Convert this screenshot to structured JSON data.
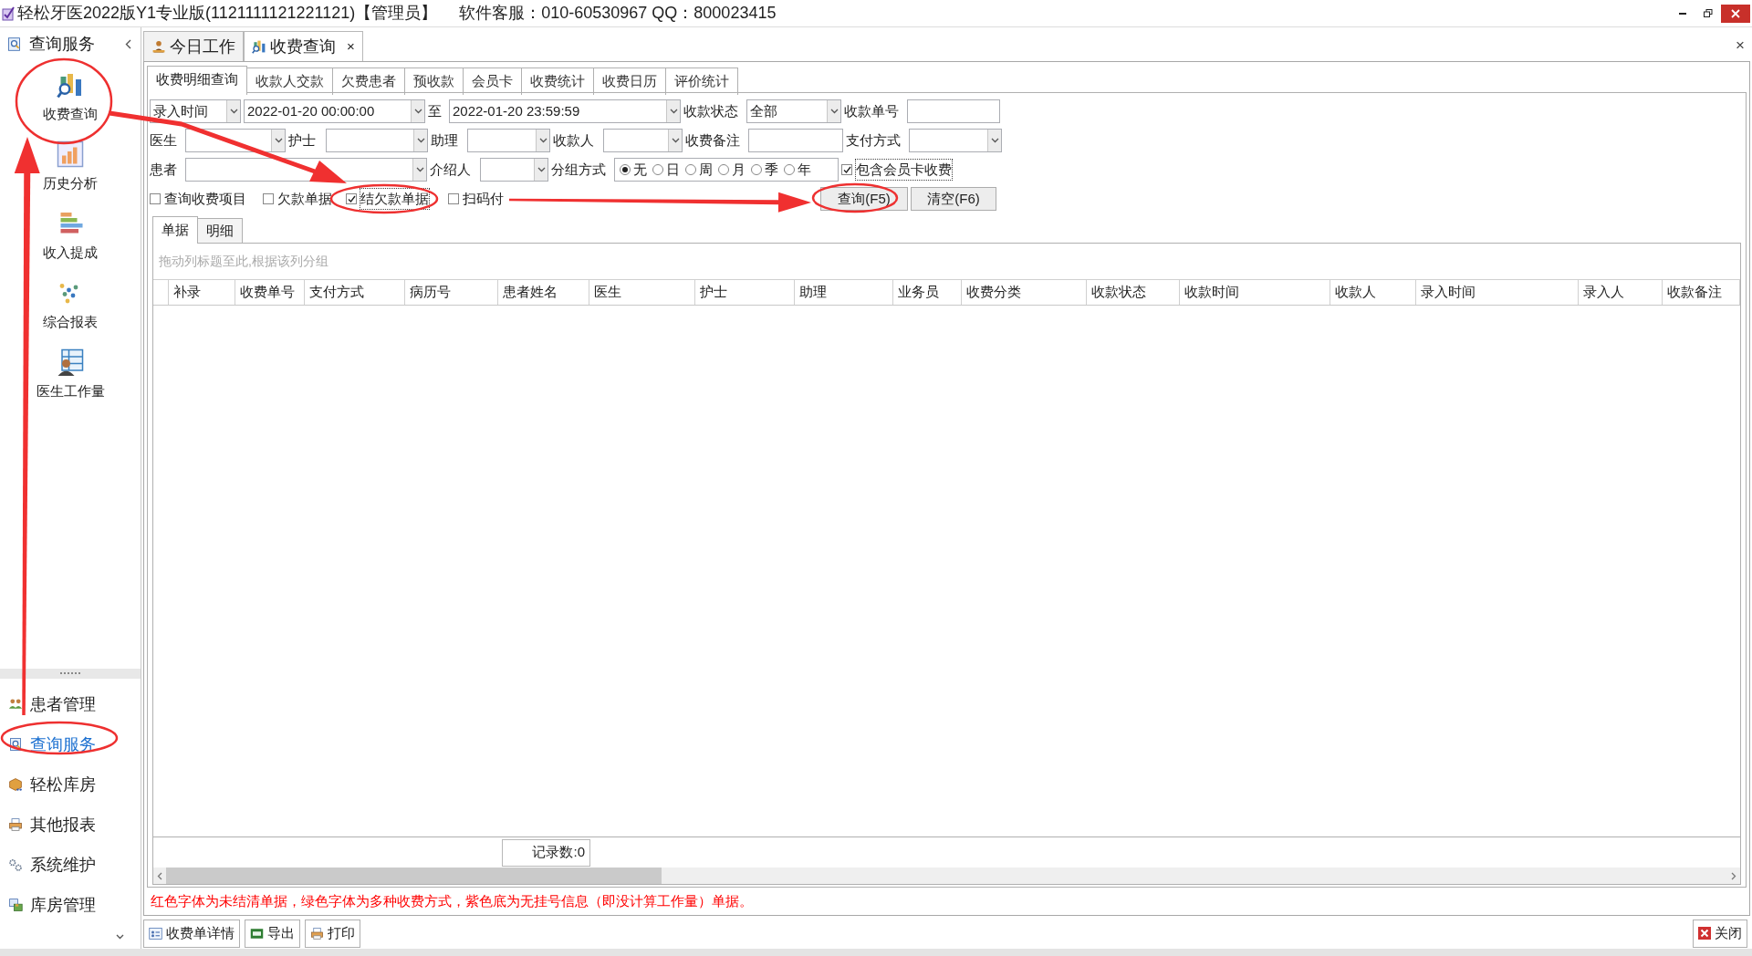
{
  "window": {
    "title": "轻松牙医2022版Y1专业版(1121111121221121)【管理员】",
    "support": "软件客服：010-60530967 QQ：800023415"
  },
  "sidebar": {
    "header": "查询服务",
    "tools": [
      {
        "label": "收费查询",
        "kind": "chart-search"
      },
      {
        "label": "历史分析",
        "kind": "bar-chart"
      },
      {
        "label": "收入提成",
        "kind": "stack"
      },
      {
        "label": "综合报表",
        "kind": "dots"
      },
      {
        "label": "医生工作量",
        "kind": "staff"
      }
    ],
    "nav": [
      {
        "label": "患者管理",
        "kind": "people",
        "selected": false
      },
      {
        "label": "查询服务",
        "kind": "search-doc",
        "selected": true
      },
      {
        "label": "轻松库房",
        "kind": "box",
        "selected": false
      },
      {
        "label": "其他报表",
        "kind": "printer",
        "selected": false
      },
      {
        "label": "系统维护",
        "kind": "gears",
        "selected": false
      },
      {
        "label": "库房管理",
        "kind": "windows",
        "selected": false
      }
    ]
  },
  "doc_tabs": [
    {
      "label": "今日工作",
      "kind": "worker",
      "selected": false,
      "closable": false
    },
    {
      "label": "收费查询",
      "kind": "chart-search",
      "selected": true,
      "closable": true
    }
  ],
  "doc_tab_close": "×",
  "panel_close": "×",
  "query_tabs": [
    {
      "label": "收费明细查询",
      "selected": true
    },
    {
      "label": "收款人交款",
      "selected": false
    },
    {
      "label": "欠费患者",
      "selected": false
    },
    {
      "label": "预收款",
      "selected": false
    },
    {
      "label": "会员卡",
      "selected": false
    },
    {
      "label": "收费统计",
      "selected": false
    },
    {
      "label": "收费日历",
      "selected": false
    },
    {
      "label": "评价统计",
      "selected": false
    }
  ],
  "filters": [
    [
      {
        "kind": "select",
        "value": "录入时间"
      },
      {
        "kind": "select",
        "value": "2022-01-20 00:00:00"
      },
      {
        "kind": "label",
        "text": "至"
      },
      {
        "kind": "select",
        "value": "2022-01-20 23:59:59"
      },
      {
        "kind": "label",
        "text": "收款状态"
      },
      {
        "kind": "select",
        "value": "全部"
      },
      {
        "kind": "label",
        "text": "收款单号"
      },
      {
        "kind": "input"
      }
    ],
    [
      {
        "kind": "label",
        "text": "医生"
      },
      {
        "kind": "select"
      },
      {
        "kind": "label",
        "text": "护士"
      },
      {
        "kind": "select"
      },
      {
        "kind": "label",
        "text": "助理"
      },
      {
        "kind": "select"
      },
      {
        "kind": "label",
        "text": "收款人"
      },
      {
        "kind": "select"
      },
      {
        "kind": "label",
        "text": "收费备注"
      },
      {
        "kind": "input"
      },
      {
        "kind": "label",
        "text": "支付方式"
      },
      {
        "kind": "select"
      }
    ],
    [
      {
        "kind": "label",
        "text": "患者"
      },
      {
        "kind": "select"
      },
      {
        "kind": "label",
        "text": "介绍人"
      },
      {
        "kind": "select"
      },
      {
        "kind": "label",
        "text": "分组方式"
      },
      {
        "kind": "radios",
        "options": [
          {
            "label": "无",
            "selected": true
          },
          {
            "label": "日",
            "selected": false
          },
          {
            "label": "周",
            "selected": false
          },
          {
            "label": "月",
            "selected": false
          },
          {
            "label": "季",
            "selected": false
          },
          {
            "label": "年",
            "selected": false
          }
        ]
      },
      {
        "kind": "checkbox",
        "label": "包含会员卡收费",
        "checked": true
      }
    ],
    [
      {
        "kind": "checkbox",
        "label": "查询收费项目",
        "checked": false
      },
      {
        "kind": "checkbox",
        "label": "欠款单据",
        "checked": false
      },
      {
        "kind": "checkbox",
        "label": "结欠款单据",
        "checked": true
      },
      {
        "kind": "checkbox",
        "label": "扫码付",
        "checked": false
      },
      {
        "kind": "button",
        "label": "查询(F5)"
      },
      {
        "kind": "button",
        "label": "清空(F6)"
      }
    ]
  ],
  "result_tabs": [
    {
      "label": "单据",
      "selected": true
    },
    {
      "label": "明细",
      "selected": false
    }
  ],
  "table": {
    "group_hint": "拖动列标题至此,根据该列分组",
    "columns": [
      "补录",
      "收费单号",
      "支付方式",
      "病历号",
      "患者姓名",
      "医生",
      "护士",
      "助理",
      "业务员",
      "收费分类",
      "收款状态",
      "收款时间",
      "收款人",
      "录入时间",
      "录入人",
      "收款备注"
    ],
    "record_count": "记录数:0"
  },
  "note": "红色字体为未结清单据，绿色字体为多种收费方式，紫色底为无挂号信息（即没计算工作量）单据。",
  "toolbar": [
    {
      "label": "收费单详情",
      "kind": "detail"
    },
    {
      "label": "导出",
      "kind": "excel"
    },
    {
      "label": "打印",
      "kind": "printer"
    }
  ],
  "close_button": {
    "label": "关闭"
  }
}
